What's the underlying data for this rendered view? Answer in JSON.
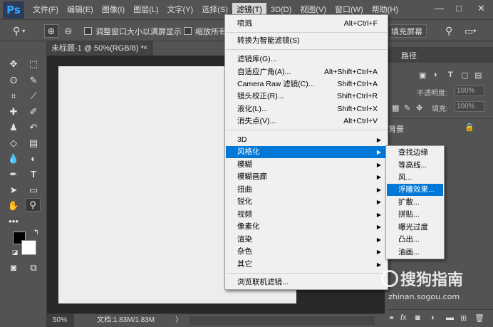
{
  "app": {
    "logo": "Ps"
  },
  "menubar": {
    "items": [
      "文件(F)",
      "编辑(E)",
      "图像(I)",
      "图层(L)",
      "文字(Y)",
      "选择(S)",
      "滤镜(T)",
      "3D(D)",
      "视图(V)",
      "窗口(W)",
      "帮助(H)"
    ],
    "active_index": 6,
    "window_controls": [
      "—",
      "□",
      "✕"
    ]
  },
  "options_bar": {
    "resize_window_label": "调整窗口大小以满屏显示",
    "zoom_all_label": "缩放所有",
    "fill_screen_label": "填充屏幕"
  },
  "document": {
    "tab_title": "未标题-1 @ 50%(RGB/8) *",
    "tab_close": "×",
    "zoom": "50%",
    "doc_size": "文档:1.83M/1.83M",
    "status_arrow": "〉"
  },
  "right_panel": {
    "tab_paths": "路径",
    "opacity_label": "不透明度:",
    "opacity_value": "100%",
    "fill_label": "填充:",
    "fill_value": "100%",
    "layer_name": "背景",
    "bottom_icons": [
      "fx"
    ]
  },
  "filter_menu": {
    "group1": [
      {
        "label": "喷溅",
        "shortcut": "Alt+Ctrl+F"
      }
    ],
    "group2": [
      {
        "label": "转换为智能滤镜(S)",
        "shortcut": ""
      }
    ],
    "group3": [
      {
        "label": "滤镜库(G)...",
        "shortcut": ""
      },
      {
        "label": "自适应广角(A)...",
        "shortcut": "Alt+Shift+Ctrl+A"
      },
      {
        "label": "Camera Raw 滤镜(C)...",
        "shortcut": "Shift+Ctrl+A"
      },
      {
        "label": "镜头校正(R)...",
        "shortcut": "Shift+Ctrl+R"
      },
      {
        "label": "液化(L)...",
        "shortcut": "Shift+Ctrl+X"
      },
      {
        "label": "消失点(V)...",
        "shortcut": "Alt+Ctrl+V"
      }
    ],
    "group4": [
      {
        "label": "3D",
        "submenu": true
      },
      {
        "label": "风格化",
        "submenu": true,
        "highlight": true
      },
      {
        "label": "模糊",
        "submenu": true
      },
      {
        "label": "模糊画廊",
        "submenu": true
      },
      {
        "label": "扭曲",
        "submenu": true
      },
      {
        "label": "锐化",
        "submenu": true
      },
      {
        "label": "视频",
        "submenu": true
      },
      {
        "label": "像素化",
        "submenu": true
      },
      {
        "label": "渲染",
        "submenu": true
      },
      {
        "label": "杂色",
        "submenu": true
      },
      {
        "label": "其它",
        "submenu": true
      }
    ],
    "group5": [
      {
        "label": "浏览联机滤镜..."
      }
    ],
    "submenu_arrow": "▶"
  },
  "stylize_submenu": {
    "items": [
      "查找边缘",
      "等高线...",
      "风...",
      "浮雕效果...",
      "扩散...",
      "拼贴...",
      "曝光过度",
      "凸出...",
      "油画..."
    ],
    "highlight_index": 3
  },
  "watermark": {
    "main": "搜狗指南",
    "url": "zhinan.sogou.com"
  },
  "colors": {
    "menu_highlight": "#0078d7",
    "ui_bg": "#535353",
    "ps_blue": "#31a8ff"
  }
}
